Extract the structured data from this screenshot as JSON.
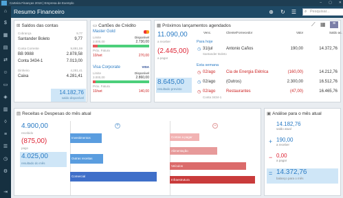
{
  "window": {
    "title": "Carteira Finanças 2018 | Empresa de Exemplo"
  },
  "header": {
    "title": "Resumo Financeiro",
    "search_placeholder": "Pesquisar..."
  },
  "balances": {
    "title": "Saldos das contas",
    "groups": [
      {
        "label": "Cobrança",
        "total": "9,77",
        "items": [
          {
            "name": "Santander Boleto",
            "value": "9,77"
          }
        ]
      },
      {
        "label": "Conta Corrente",
        "total": "9,891,59",
        "items": [
          {
            "name": "BB 9988",
            "value": "2.878,58"
          },
          {
            "name": "Conta 3434-1",
            "value": "7.013,00"
          }
        ]
      },
      {
        "label": "Dinheiro",
        "total": "4,281,41",
        "items": [
          {
            "name": "Caixa",
            "value": "4.281,41"
          }
        ]
      }
    ],
    "total": "14.182,76",
    "total_label": "saldo disponível"
  },
  "cards": {
    "title": "Cartões de Crédito",
    "list": [
      {
        "name": "Master Gold",
        "limit_label": "Limite",
        "limit": "3.000,00",
        "avail_label": "Disponível",
        "avail": "2.730,00",
        "invoice_label": "Próx. Fatura",
        "invoice": "270,00",
        "due": "10/set",
        "used_fraction": 0.09
      },
      {
        "name": "Visa Corporate",
        "limit_label": "Limite",
        "limit": "3.000,00",
        "avail_label": "Disponível",
        "avail": "2.860,00",
        "invoice_label": "Próx. Fatura",
        "invoice": "140,00",
        "due": "10/set",
        "used_fraction": 0.05
      }
    ]
  },
  "upcoming": {
    "title": "Próximos lançamentos agendados",
    "receive": "11.090,00",
    "receive_label": "a receber",
    "pay": "(2.445,00)",
    "pay_label": "a pagar",
    "forecast": "8.645,00",
    "forecast_label": "resultado previsto",
    "columns": [
      "Venc.",
      "Cliente/Fornecedor",
      "Valor",
      "Saldo ac."
    ],
    "sections": [
      {
        "label": "Para hoje",
        "rows": [
          {
            "date": "31/jul",
            "party": "Antonio Caños",
            "value": "190,00",
            "balance": "14.372,76",
            "sub": "Santander Boleto",
            "negative": false
          }
        ]
      },
      {
        "label": "Esta semana",
        "rows": [
          {
            "date": "02/ago",
            "party": "Cia de Energia Elétrica",
            "value": "(160,00)",
            "balance": "14.212,76",
            "negative": true
          },
          {
            "date": "02/ago",
            "party": "(Outros)",
            "value": "2.300,00",
            "balance": "16.512,76",
            "negative": false
          },
          {
            "date": "02/ago",
            "party": "Restaurantes",
            "value": "(47,00)",
            "balance": "16.465,76",
            "negative": true,
            "sub": "Conta 3434-1"
          }
        ]
      }
    ]
  },
  "revexp": {
    "title": "Receitas e Despesas do mês atual",
    "income": "4.900,00",
    "income_label": "recebido",
    "expense": "(875,00)",
    "expense_label": "pago",
    "result": "4.025,00",
    "result_label": "resultado do mês",
    "income_cats": [
      {
        "name": "Investimentos",
        "fraction": 0.35
      },
      {
        "name": "Outras receitas",
        "fraction": 0.37
      },
      {
        "name": "Comercial",
        "fraction": 0.97
      }
    ],
    "expense_cats": [
      {
        "name": "Contas a pagar",
        "fraction": 0.33
      },
      {
        "name": "Alimentação",
        "fraction": 0.53
      },
      {
        "name": "Veículos",
        "fraction": 0.85
      },
      {
        "name": "Infraestrutura",
        "fraction": 0.95
      }
    ]
  },
  "analysis": {
    "title": "Análise para o mês atual",
    "rows": [
      {
        "sign": "",
        "value": "14.182,76",
        "label": "saldo atual",
        "color": "#2a7bc4"
      },
      {
        "sign": "+",
        "value": "190,00",
        "label": "a receber",
        "color": "#2a7bc4"
      },
      {
        "sign": "−",
        "value": "0,00",
        "label": "a pagar",
        "color": "#d23"
      },
      {
        "sign": "=",
        "value": "14.372,76",
        "label": "balanço para o mês",
        "color": "#2a7bc4"
      }
    ]
  }
}
